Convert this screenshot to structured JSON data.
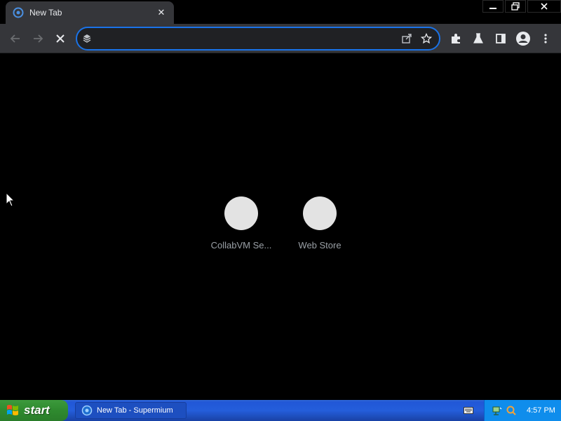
{
  "tab": {
    "title": "New Tab",
    "favicon": "supermium-icon",
    "close": "✕"
  },
  "window": {
    "controls": [
      "minimize",
      "restore",
      "close"
    ]
  },
  "toolbar": {
    "back": "back-arrow-icon",
    "forward": "forward-arrow-icon",
    "stop": "stop-icon",
    "omnibox": {
      "value": "",
      "placeholder": ""
    },
    "icons": [
      "share-icon",
      "bookmark-star-icon",
      "extensions-icon",
      "labs-icon",
      "side-panel-icon",
      "profile-icon",
      "menu-icon"
    ]
  },
  "shortcuts": [
    {
      "label": "CollabVM Se..."
    },
    {
      "label": "Web Store"
    }
  ],
  "taskbar": {
    "start_label": "start",
    "task_label": "New Tab - Supermium",
    "clock": "4:57 PM"
  },
  "colors": {
    "accent": "#1a73e8",
    "toolbar": "#35363a",
    "taskbar": "#245edb",
    "start": "#3c9a3c"
  }
}
